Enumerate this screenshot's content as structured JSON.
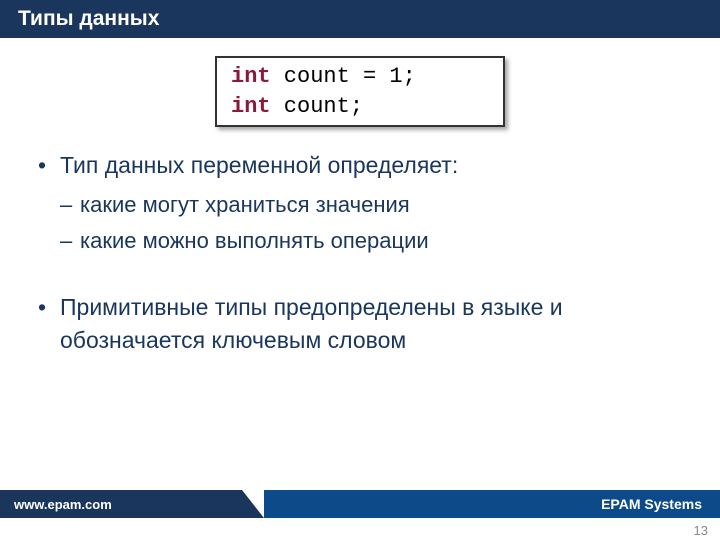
{
  "header": {
    "title": "Типы данных"
  },
  "code": {
    "line1_kw": "int",
    "line1_rest": " count = 1;",
    "line2_kw": "int",
    "line2_rest": " count;"
  },
  "bullets": {
    "b1": "Тип данных переменной определяет:",
    "b1_sub1": "какие могут храниться значения",
    "b1_sub2": "какие можно выполнять операции",
    "b2": "Примитивные типы предопределены в языке и обозначается ключевым словом"
  },
  "footer": {
    "left": "www.epam.com",
    "right": "EPAM Systems"
  },
  "page_number": "13"
}
